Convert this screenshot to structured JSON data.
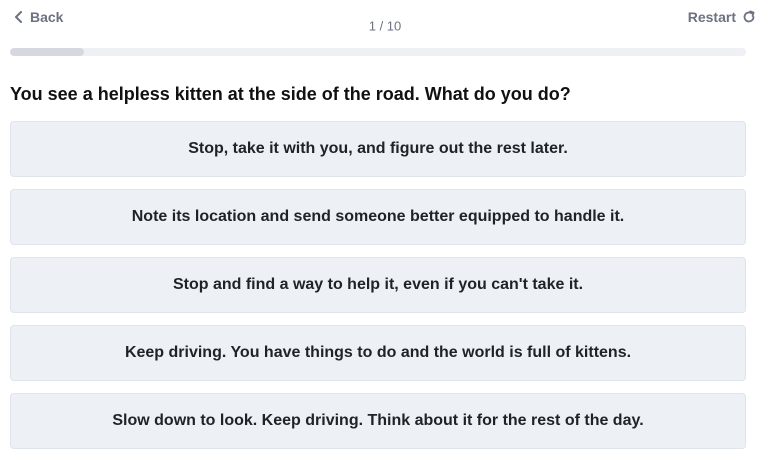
{
  "nav": {
    "back_label": "Back",
    "back_icon": "chevron-left-icon",
    "counter": "1 / 10",
    "restart_label": "Restart",
    "restart_icon": "redo-icon"
  },
  "progress": {
    "current": 1,
    "total": 10,
    "fraction": 0.1
  },
  "question": {
    "text": "You see a helpless kitten at the side of the road. What do you do?"
  },
  "options": [
    {
      "label": "Stop, take it with you, and figure out the rest later."
    },
    {
      "label": "Note its location and send someone better equipped to handle it."
    },
    {
      "label": "Stop and find a way to help it, even if you can't take it."
    },
    {
      "label": "Keep driving. You have things to do and the world is full of kittens."
    },
    {
      "label": "Slow down to look. Keep driving. Think about it for the rest of the day."
    }
  ],
  "colors": {
    "muted_text": "#6b7280",
    "option_bg": "#edf1f6",
    "progress_track": "#eef0f3"
  }
}
